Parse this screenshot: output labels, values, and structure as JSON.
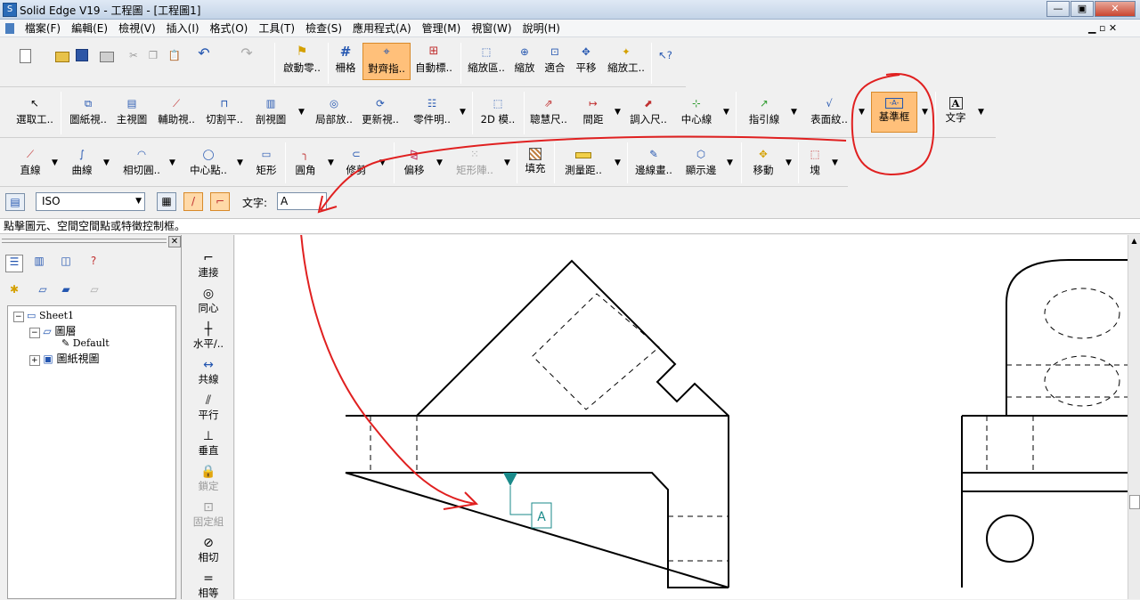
{
  "window": {
    "title": "Solid Edge V19 - 工程圖 - [工程圖1]"
  },
  "menu": [
    "檔案(F)",
    "編輯(E)",
    "檢視(V)",
    "插入(I)",
    "格式(O)",
    "工具(T)",
    "檢查(S)",
    "應用程式(A)",
    "管理(M)",
    "視窗(W)",
    "說明(H)"
  ],
  "toolbar1": {
    "open_parts": "啟動零..",
    "grid": "柵格",
    "align": "對齊指..",
    "auto_label": "自動標..",
    "zoom_area": "縮放區..",
    "zoom": "縮放",
    "fit": "適合",
    "pan": "平移",
    "zoom_tool": "縮放工.."
  },
  "toolbar2": {
    "select": "選取工..",
    "drawing_view": "圖紙視..",
    "main_view": "主視圖",
    "aux_view": "輔助視..",
    "cut_plane": "切割平..",
    "section_view": "剖視圖",
    "detail_view": "局部放..",
    "update_view": "更新視..",
    "parts_list": "零件明..",
    "model_2d": "2D 模..",
    "smart_dim": "聰慧尺..",
    "distance": "間距",
    "import_dim": "調入尺..",
    "center_line": "中心線",
    "leader": "指引線",
    "surface_texture": "表面紋..",
    "datum_frame": "基準框",
    "text": "文字"
  },
  "toolbar3": {
    "line": "直線",
    "curve": "曲線",
    "tangent_arc": "相切圓..",
    "center_point": "中心點..",
    "rectangle": "矩形",
    "fillet": "圓角",
    "trim": "修剪",
    "offset": "偏移",
    "rect_array": "矩形陣..",
    "fill": "填充",
    "measure": "測量距..",
    "edge_paint": "邊線畫..",
    "show_edge": "顯示邊",
    "move": "移動",
    "block": "塊"
  },
  "ribbon": {
    "standard_value": "ISO",
    "text_label": "文字:",
    "text_value": "A"
  },
  "status": {
    "prompt": "點擊圖元、空間空間點或特徵控制框。"
  },
  "tree": {
    "sheet": "Sheet1",
    "layers": "圖層",
    "default": "Default",
    "drawing_views": "圖紙視圖"
  },
  "relations": [
    "連接",
    "同心",
    "水平/..",
    "共線",
    "平行",
    "垂直",
    "鎖定",
    "固定組",
    "相切",
    "相等"
  ],
  "datum": {
    "label": "A"
  },
  "colors": {
    "accent": "#ffc07a",
    "annotation": "#e02020",
    "datum": "#1a8a8a"
  }
}
